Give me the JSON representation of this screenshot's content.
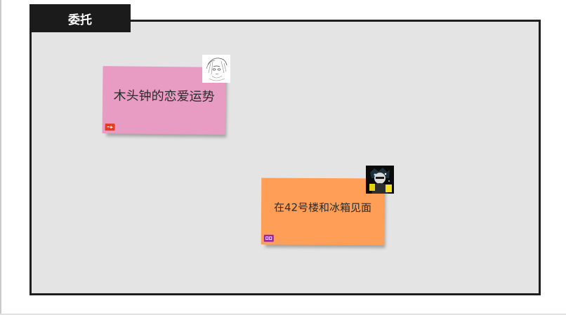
{
  "board": {
    "tab_label": "委托"
  },
  "commissions": [
    {
      "title": "木头钟的恋爱运势",
      "color": "#e99cc3",
      "badge_color": "#e8391f",
      "avatar_icon": "anime-sketch-avatar-icon"
    },
    {
      "title": "在42号楼和冰箱见面",
      "color": "#ff9f57",
      "badge_color": "#9326a8",
      "avatar_icon": "dark-character-avatar-icon"
    }
  ]
}
